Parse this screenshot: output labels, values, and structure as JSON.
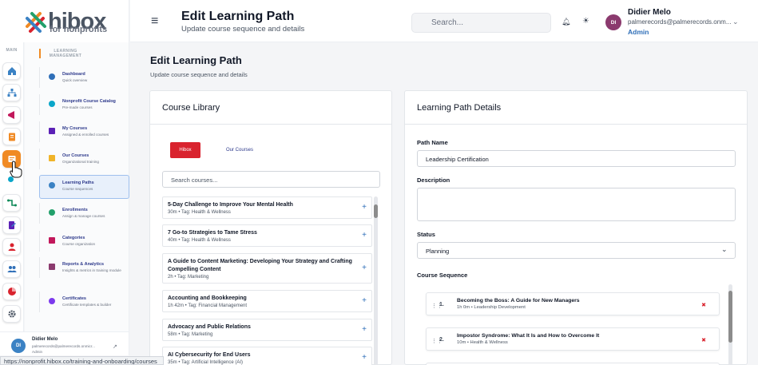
{
  "brand": {
    "word": "hibox",
    "sub": "for nonprofits"
  },
  "rail": {
    "label": "MAIN"
  },
  "sidebar": {
    "section": "LEARNING MANAGEMENT",
    "items": [
      {
        "label": "Dashboard",
        "desc": "Quick overview"
      },
      {
        "label": "Nonprofit Course Catalog",
        "desc": "Pre-made courses"
      },
      {
        "label": "My Courses",
        "desc": "Assigned & enrolled courses"
      },
      {
        "label": "Our Courses",
        "desc": "Organizational training"
      },
      {
        "label": "Learning Paths",
        "desc": "Course sequences"
      },
      {
        "label": "Enrollments",
        "desc": "Assign & manage courses"
      },
      {
        "label": "Categories",
        "desc": "Course organization"
      },
      {
        "label": "Reports & Analytics",
        "desc": "Insights & metrics in training module"
      },
      {
        "label": "Certificates",
        "desc": "Certificate templates & builder"
      }
    ],
    "user": {
      "initials": "DI",
      "name": "Didier Melo",
      "email": "palmerecords@palmerecords.onmicr...",
      "role": "Admin"
    }
  },
  "header": {
    "title": "Edit Learning Path",
    "subtitle": "Update course sequence and details",
    "search_placeholder": "Search...",
    "user": {
      "initials": "DI",
      "name": "Didier Melo",
      "email": "palmerecords@palmerecords.onm...",
      "role": "Admin"
    }
  },
  "page": {
    "title": "Edit Learning Path",
    "subtitle": "Update course sequence and details"
  },
  "library": {
    "title": "Course Library",
    "tabs": [
      "Hibox",
      "Our Courses"
    ],
    "search_placeholder": "Search courses...",
    "courses": [
      {
        "title": "5-Day Challenge to Improve Your Mental Health",
        "meta": "30m  •  Tag: Health & Wellness"
      },
      {
        "title": "7 Go-to Strategies to Tame Stress",
        "meta": "40m  •  Tag: Health & Wellness"
      },
      {
        "title": "A Guide to Content Marketing: Developing Your Strategy and Crafting Compelling Content",
        "meta": "2h  •  Tag: Marketing"
      },
      {
        "title": "Accounting and Bookkeeping",
        "meta": "1h 42m  •  Tag: Financial Management"
      },
      {
        "title": "Advocacy and Public Relations",
        "meta": "58m  •  Tag: Marketing"
      },
      {
        "title": "AI Cybersecurity for End Users",
        "meta": "35m  •  Tag: Artificial Intelligence (AI)"
      }
    ]
  },
  "details": {
    "title": "Learning Path Details",
    "path_name_label": "Path Name",
    "path_name_value": "Leadership Certification",
    "description_label": "Description",
    "status_label": "Status",
    "status_value": "Planning",
    "sequence_label": "Course Sequence",
    "sequence": [
      {
        "num": "1.",
        "title": "Becoming the Boss: A Guide for New Managers",
        "meta": "1h 0m • Leadership Development"
      },
      {
        "num": "2.",
        "title": "Impostor Syndrome: What It Is and How to Overcome It",
        "meta": "10m • Health & Wellness"
      }
    ]
  },
  "statusbar": {
    "url": "https://nonprofit.hibox.co/training-and-onboarding/courses"
  },
  "colors": {
    "accent": "#f08a24",
    "brand_red": "#d9232e",
    "link_blue": "#2f6fb8"
  }
}
